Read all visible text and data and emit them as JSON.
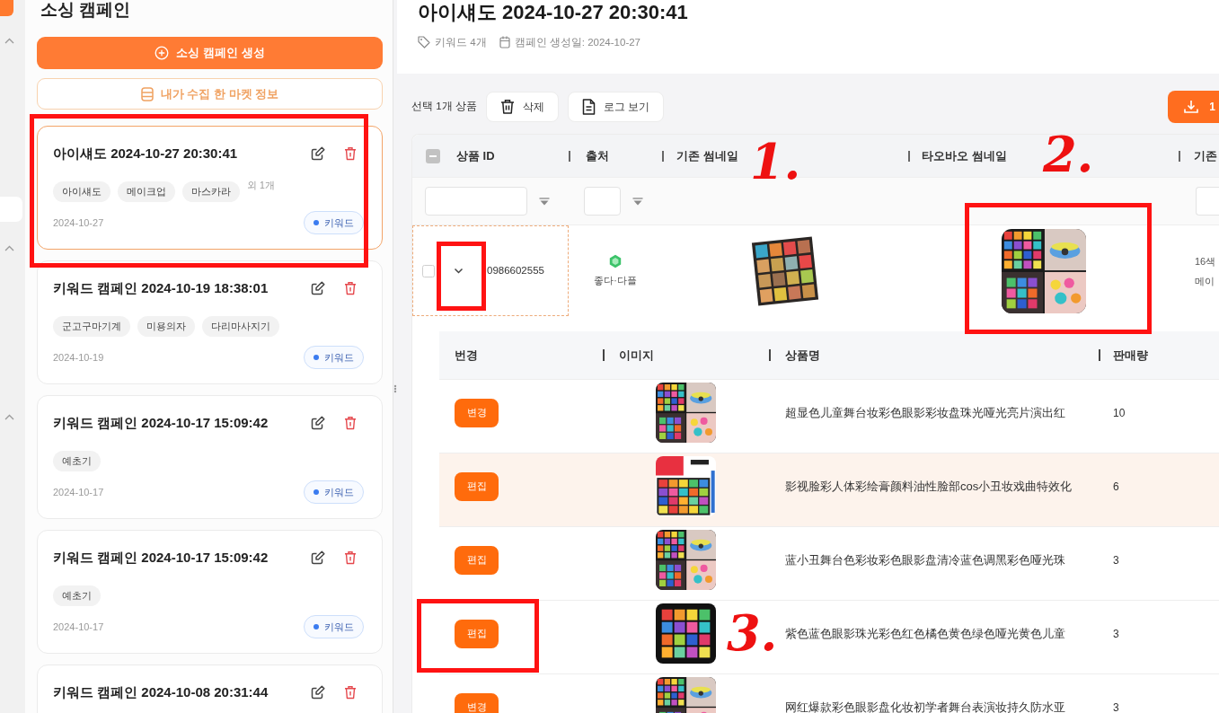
{
  "sidebar": {
    "title": "소싱 캠페인",
    "create_button": "소싱 캠페인 생성",
    "market_button": "내가 수집 한 마켓 정보",
    "campaigns": [
      {
        "title": "아이섀도 2024-10-27 20:30:41",
        "tags": [
          "아이섀도",
          "메이크업",
          "마스카라"
        ],
        "more": "외 1개",
        "date": "2024-10-27",
        "type": "키워드",
        "selected": true,
        "marked": true
      },
      {
        "title": "키워드 캠페인 2024-10-19 18:38:01",
        "tags": [
          "군고구마기계",
          "미용의자",
          "다리마사지기"
        ],
        "date": "2024-10-19",
        "type": "키워드",
        "selected": false,
        "marked": false
      },
      {
        "title": "키워드 캠페인 2024-10-17 15:09:42",
        "tags": [
          "예초기"
        ],
        "date": "2024-10-17",
        "type": "키워드",
        "selected": false,
        "marked": false
      },
      {
        "title": "키워드 캠페인 2024-10-17 15:09:42",
        "tags": [
          "예초기"
        ],
        "date": "2024-10-17",
        "type": "키워드",
        "selected": false,
        "marked": false
      },
      {
        "title": "키워드 캠페인 2024-10-08 20:31:44",
        "selected": false,
        "marked": false
      }
    ]
  },
  "header": {
    "title": "아이섀도 2024-10-27 20:30:41",
    "keywords": "키워드 4개",
    "created": "캠페인 생성일: 2024-10-27"
  },
  "toolbar": {
    "selection": "선택 1개 상품",
    "buttons": [
      {
        "kind": "delete",
        "label": "삭제"
      },
      {
        "kind": "log",
        "label": "로그 보기"
      }
    ],
    "download_button": "1"
  },
  "table": {
    "select_all": {
      "indeterminate": true
    },
    "columns": [
      {
        "label": "상품 ID",
        "filter": true,
        "filter_icon": true
      },
      {
        "label": "출처",
        "filter": true,
        "filter_icon": true
      },
      {
        "label": "기존 썸네일",
        "note": "1."
      },
      {
        "label": "타오바오 썸네일",
        "note": "2."
      },
      {
        "label": "기존",
        "filter": true
      }
    ],
    "rows": [
      {
        "checked": false,
        "expanded": true,
        "focused": true,
        "toggle_marked": true,
        "product_id": "0986602555",
        "source": "좋다·다플",
        "thumbnail_marked": true,
        "column_5": [
          "16색",
          "메이"
        ],
        "sub_table": {
          "columns": [
            "번경",
            "이미지",
            "상품명",
            "판매량"
          ],
          "rows": [
            {
              "button": "변경",
              "name": "超显色儿童舞台妆彩色眼影彩妆盘珠光哑光亮片演出红",
              "sales": "10",
              "highlighted": false,
              "marked": false
            },
            {
              "button": "편집",
              "name": "影视脸彩人体彩绘膏颜料油性脸部cos小丑妆戏曲特效化",
              "sales": "6",
              "highlighted": true,
              "marked": false
            },
            {
              "button": "편집",
              "name": "蓝小丑舞台色彩妆彩色眼影盘清冷蓝色调黑彩色哑光珠",
              "sales": "3",
              "highlighted": false,
              "marked": false
            },
            {
              "button": "편집",
              "name": "紫色蓝色眼影珠光彩色红色橘色黄色绿色哑光黄色儿童",
              "sales": "3",
              "highlighted": false,
              "marked": true,
              "note": "3."
            },
            {
              "button": "변경",
              "name": "网红爆款彩色眼影盘化妆初学者舞台表演妆持久防水亚",
              "sales": "3",
              "highlighted": false,
              "marked": false
            }
          ]
        }
      }
    ]
  }
}
